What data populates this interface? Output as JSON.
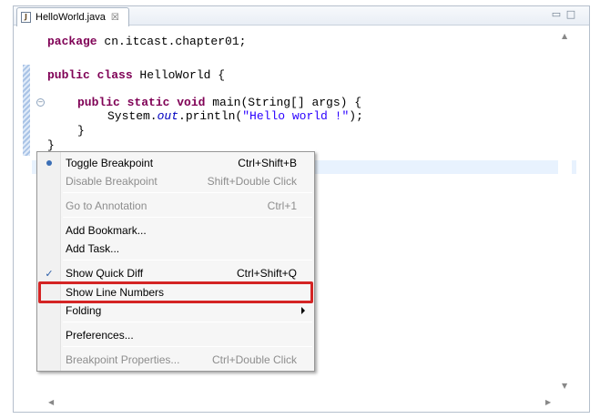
{
  "tab": {
    "icon": "java-file-icon",
    "label": "HelloWorld.java",
    "close": "☒"
  },
  "window_controls": {
    "minimize": "▭",
    "maximize": "□"
  },
  "code_lines": {
    "l1_kw": "package",
    "l1_rest": " cn.itcast.chapter01;",
    "l2_kw": "public class",
    "l2_rest": " HelloWorld {",
    "l3_kw": "public static void",
    "l3_rest": " main(String[] args) {",
    "l4_a": "System.",
    "l4_field": "out",
    "l4_b": ".println(",
    "l4_str": "\"Hello world !\"",
    "l4_c": ");",
    "l5": "}",
    "l6": "}"
  },
  "context_menu": {
    "toggle_breakpoint": {
      "label": "Toggle Breakpoint",
      "shortcut": "Ctrl+Shift+B"
    },
    "disable_breakpoint": {
      "label": "Disable Breakpoint",
      "shortcut": "Shift+Double Click"
    },
    "go_to_annotation": {
      "label": "Go to Annotation",
      "shortcut": "Ctrl+1"
    },
    "add_bookmark": {
      "label": "Add Bookmark..."
    },
    "add_task": {
      "label": "Add Task..."
    },
    "show_quick_diff": {
      "label": "Show Quick Diff",
      "shortcut": "Ctrl+Shift+Q",
      "checked": true,
      "check": "✓"
    },
    "show_line_numbers": {
      "label": "Show Line Numbers",
      "highlighted": true
    },
    "folding": {
      "label": "Folding"
    },
    "preferences": {
      "label": "Preferences..."
    },
    "breakpoint_properties": {
      "label": "Breakpoint Properties...",
      "shortcut": "Ctrl+Double Click"
    }
  },
  "colors": {
    "keyword": "#7f0055",
    "string": "#2a00ff",
    "field": "#0000c0",
    "highlight_box": "#d42424",
    "current_line": "#e8f2fe"
  }
}
